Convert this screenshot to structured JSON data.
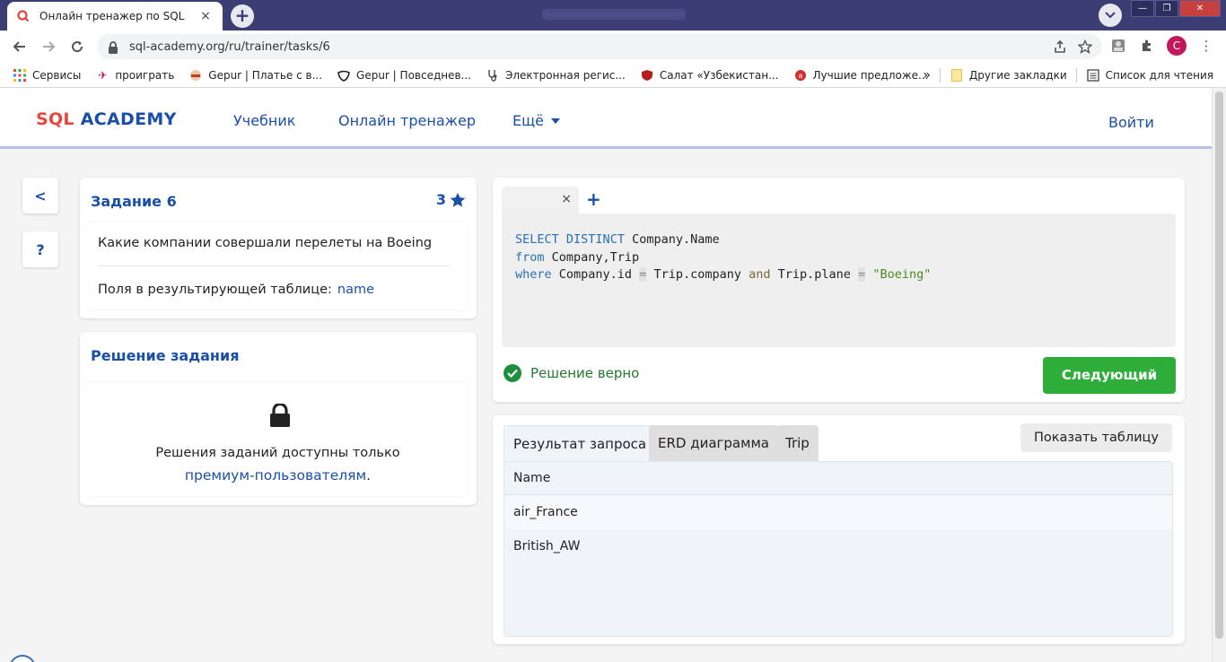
{
  "browser": {
    "tab_title": "Онлайн тренажер по SQL",
    "tab_close": "×",
    "new_tab": "+",
    "url": "sql-academy.org/ru/trainer/tasks/6",
    "profile_initial": "C",
    "bookmarks": [
      {
        "label": "Сервисы",
        "icon": "apps-grid-icon"
      },
      {
        "label": "проиграть",
        "icon": "game-icon"
      },
      {
        "label": "Gepur | Платье с в...",
        "icon": "gepur-face-icon"
      },
      {
        "label": "Gepur | Повседнев...",
        "icon": "gepur-mask-icon"
      },
      {
        "label": "Электронная регис...",
        "icon": "stethoscope-icon"
      },
      {
        "label": "Салат «Узбекистан...",
        "icon": "shield-bird-icon"
      },
      {
        "label": "Лучшие предложе...",
        "icon": "ad-circle-icon"
      }
    ],
    "bookmarks_more": "»",
    "other_bookmarks": "Другие закладки",
    "reading_list": "Список для чтения"
  },
  "header": {
    "logo_sql": "SQL",
    "logo_academy": "ACADEMY",
    "nav": {
      "textbook": "Учебник",
      "trainer": "Онлайн тренажер",
      "more": "Ещё"
    },
    "login": "Войти"
  },
  "sidebar": {
    "back": "<",
    "help": "?"
  },
  "task": {
    "title": "Задание 6",
    "stars": "3",
    "question": "Какие компании совершали перелеты на Boeing",
    "fields_label": "Поля в результирующей таблице:",
    "fields_value": "name"
  },
  "solution": {
    "title": "Решение задания",
    "text": "Решения заданий доступны только",
    "link": "премиум-пользователям",
    "link_suffix": "."
  },
  "editor": {
    "tab_close": "×",
    "add_tab": "+",
    "code_lines": [
      [
        [
          "kw",
          "SELECT"
        ],
        [
          "ident",
          " "
        ],
        [
          "kw",
          "DISTINCT"
        ],
        [
          "ident",
          " Company.Name"
        ]
      ],
      [
        [
          "kw",
          "from"
        ],
        [
          "ident",
          " Company,Trip"
        ]
      ],
      [
        [
          "kw",
          "where"
        ],
        [
          "ident",
          " Company.id "
        ],
        [
          "op",
          "="
        ],
        [
          "ident",
          " Trip.company "
        ],
        [
          "kw2",
          "and"
        ],
        [
          "ident",
          " Trip.plane "
        ],
        [
          "op",
          "="
        ],
        [
          "ident",
          " "
        ],
        [
          "str",
          "\"Boeing\""
        ]
      ]
    ],
    "status": "Решение верно",
    "next_button": "Следующий"
  },
  "results": {
    "tabs": [
      "Результат запроса",
      "ERD диаграмма",
      "Trip"
    ],
    "active_tab": 0,
    "show_table_button": "Показать таблицу",
    "columns": [
      "Name"
    ],
    "rows": [
      [
        "air_France"
      ],
      [
        "British_AW"
      ]
    ]
  },
  "colors": {
    "brand_blue": "#1a4fa8",
    "logo_red": "#e8453c",
    "success_green": "#2fad3a",
    "chrome_tabbar": "#3b3d73"
  }
}
